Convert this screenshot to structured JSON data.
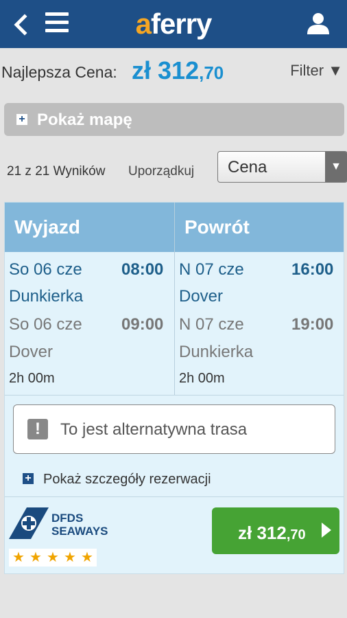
{
  "header": {
    "back_icon": "back-arrow-icon",
    "menu_icon": "hamburger-menu-icon",
    "logo_a": "a",
    "logo_rest": "ferry",
    "user_icon": "user-icon",
    "bar_color": "#1e4f87",
    "logo_accent": "#f5a623"
  },
  "price": {
    "label": "Najlepsza Cena:",
    "currency": "zł",
    "whole": "312",
    "decimals": ",70",
    "color": "#1a8fd0"
  },
  "filter": {
    "label": "Filter",
    "icon": "caret-down-icon"
  },
  "map_button": {
    "label": "Pokaż mapę",
    "icon": "plus-icon"
  },
  "results": {
    "count": "21 z 21 Wyników",
    "sort_label": "Uporządkuj",
    "sort_value": "Cena"
  },
  "trip": {
    "outbound_heading": "Wyjazd",
    "return_heading": "Powrót",
    "outbound": {
      "depart_date": "So 06 cze",
      "depart_time": "08:00",
      "depart_port": "Dunkierka",
      "arrive_date": "So 06 cze",
      "arrive_time": "09:00",
      "arrive_port": "Dover",
      "duration": "2h 00m"
    },
    "return": {
      "depart_date": "N 07 cze",
      "depart_time": "16:00",
      "depart_port": "Dover",
      "arrive_date": "N 07 cze",
      "arrive_time": "19:00",
      "arrive_port": "Dunkierka",
      "duration": "2h 00m"
    },
    "alternative_notice": "To jest alternatywna trasa",
    "alternative_icon": "exclamation-icon",
    "details_link": "Pokaż szczegóły rezerwacji",
    "operator": {
      "line1": "DFDS",
      "line2": "SEAWAYS",
      "logo_icon": "dfds-cross-logo"
    },
    "rating_stars": 5,
    "book": {
      "currency": "zł",
      "whole": "312",
      "decimals": ",70",
      "icon": "chevron-right-icon",
      "color": "#46a334"
    }
  }
}
